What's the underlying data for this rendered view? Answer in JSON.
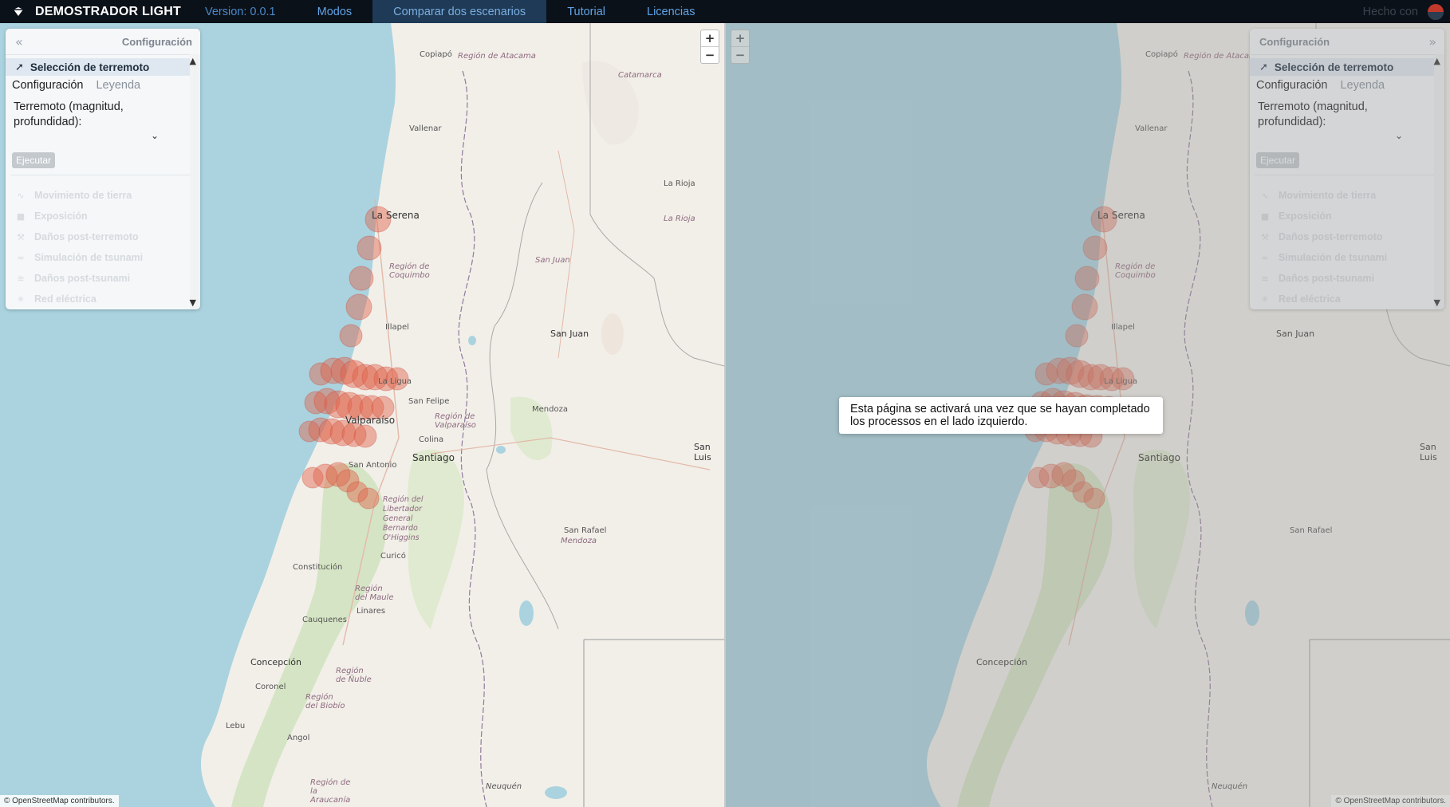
{
  "topbar": {
    "brand": "DEMOSTRADOR LIGHT",
    "version": "Version: 0.0.1",
    "nav": [
      "Modos",
      "Comparar dos escenarios",
      "Tutorial",
      "Licencias"
    ],
    "active_nav": "Comparar dos escenarios",
    "made_with": "Hecho con"
  },
  "map": {
    "places": [
      {
        "name": "Copiapó"
      },
      {
        "name": "Región de Atacama"
      },
      {
        "name": "Catamarca"
      },
      {
        "name": "Vallenar"
      },
      {
        "name": "La Rioja"
      },
      {
        "name": "La Rioja"
      },
      {
        "name": "La Serena"
      },
      {
        "name": "Región de Coquimbo"
      },
      {
        "name": "San Juan"
      },
      {
        "name": "San Juan"
      },
      {
        "name": "Illapel"
      },
      {
        "name": "La Ligua"
      },
      {
        "name": "San Felipe"
      },
      {
        "name": "Mendoza"
      },
      {
        "name": "Región de Valparaíso"
      },
      {
        "name": "Valparaíso"
      },
      {
        "name": "Colina"
      },
      {
        "name": "Santiago"
      },
      {
        "name": "San Luis"
      },
      {
        "name": "San Antonio"
      },
      {
        "name": "Región del Libertador General Bernardo O'Higgins"
      },
      {
        "name": "San Rafael"
      },
      {
        "name": "Mendoza"
      },
      {
        "name": "Constitución"
      },
      {
        "name": "Curicó"
      },
      {
        "name": "Región del Maule"
      },
      {
        "name": "Linares"
      },
      {
        "name": "Cauquenes"
      },
      {
        "name": "Concepción"
      },
      {
        "name": "Región de Ñuble"
      },
      {
        "name": "Coronel"
      },
      {
        "name": "Región del Biobío"
      },
      {
        "name": "Lebu"
      },
      {
        "name": "Angol"
      },
      {
        "name": "Región de la Araucanía"
      },
      {
        "name": "Neuquén"
      }
    ],
    "attribution": "© OpenStreetMap contributors.",
    "zoom_in": "+",
    "zoom_out": "−"
  },
  "panel_left": {
    "title": "Configuración",
    "section": "Selección de terremoto",
    "tabs": [
      "Configuración",
      "Leyenda"
    ],
    "field_label": "Terremoto (magnitud, profundidad):",
    "run_button": "Ejecutar",
    "steps": [
      {
        "label": "Movimiento de tierra",
        "icon": "wave-icon"
      },
      {
        "label": "Exposición",
        "icon": "building-icon"
      },
      {
        "label": "Daños post-terremoto",
        "icon": "hammer-icon"
      },
      {
        "label": "Simulación de tsunami",
        "icon": "tsunami-icon"
      },
      {
        "label": "Daños post-tsunami",
        "icon": "tsunami-damage-icon"
      },
      {
        "label": "Red eléctrica",
        "icon": "power-icon"
      }
    ]
  },
  "panel_right": {
    "title": "Configuración",
    "section": "Selección de terremoto",
    "tabs": [
      "Configuración",
      "Leyenda"
    ],
    "field_label": "Terremoto (magnitud, profundidad):",
    "run_button": "Ejecutar",
    "steps": [
      {
        "label": "Movimiento de tierra",
        "icon": "wave-icon"
      },
      {
        "label": "Exposición",
        "icon": "building-icon"
      },
      {
        "label": "Daños post-terremoto",
        "icon": "hammer-icon"
      },
      {
        "label": "Simulación de tsunami",
        "icon": "tsunami-icon"
      },
      {
        "label": "Daños post-tsunami",
        "icon": "tsunami-damage-icon"
      },
      {
        "label": "Red eléctrica",
        "icon": "power-icon"
      }
    ]
  },
  "overlay": {
    "message": "Esta página se activará una vez que se hayan completado los processos en el lado izquierdo."
  },
  "colors": {
    "topbar": "#0b1119",
    "nav_text": "#5fa3e6",
    "nav_active_bg": "#1e3a56",
    "ocean": "#aad3df",
    "land": "#f2efe9",
    "marker": "#e0614a"
  }
}
